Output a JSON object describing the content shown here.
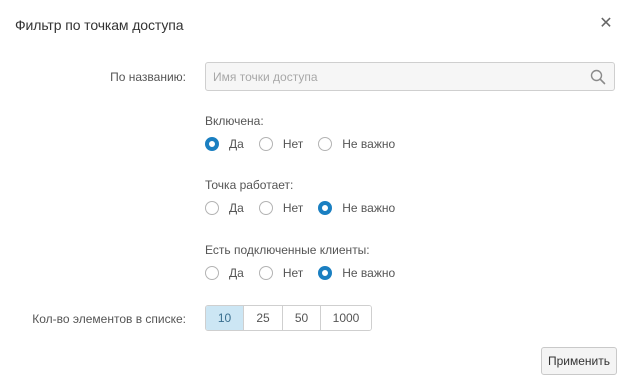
{
  "dialog": {
    "title": "Фильтр по точкам доступа",
    "close_icon": "close-icon"
  },
  "name_filter": {
    "label": "По названию:",
    "value": "",
    "placeholder": "Имя точки доступа",
    "icon": "search-icon"
  },
  "enabled": {
    "label": "Включена:",
    "options": [
      "Да",
      "Нет",
      "Не важно"
    ],
    "selected": "Да"
  },
  "working": {
    "label": "Точка работает:",
    "options": [
      "Да",
      "Нет",
      "Не важно"
    ],
    "selected": "Не важно"
  },
  "clients": {
    "label": "Есть подключенные клиенты:",
    "options": [
      "Да",
      "Нет",
      "Не важно"
    ],
    "selected": "Не важно"
  },
  "page_size": {
    "label": "Кол-во элементов в списке:",
    "options": [
      "10",
      "25",
      "50",
      "1000"
    ],
    "selected": "10"
  },
  "apply_label": "Применить",
  "colors": {
    "accent": "#1a7fc1",
    "active_segment": "#cce6f4"
  }
}
